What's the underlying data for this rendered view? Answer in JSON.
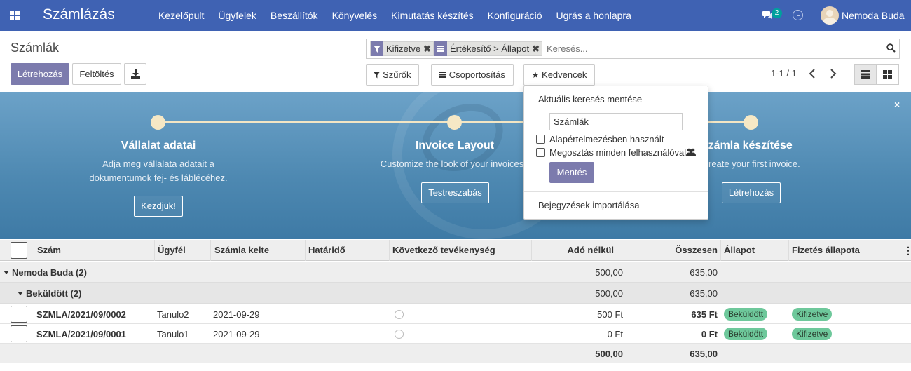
{
  "navbar": {
    "brand": "Számlázás",
    "menu": [
      "Kezelőpult",
      "Ügyfelek",
      "Beszállítók",
      "Könyvelés",
      "Kimutatás készítés",
      "Konfiguráció",
      "Ugrás a honlapra"
    ],
    "chat_count": "2",
    "user": "Nemoda Buda",
    "icons": [
      "apps-icon",
      "chat-icon",
      "clock-icon",
      "avatar"
    ]
  },
  "control": {
    "breadcrumb": "Számlák",
    "create_label": "Létrehozás",
    "upload_label": "Feltöltés",
    "filters_label": "Szűrők",
    "groupby_label": "Csoportosítás",
    "favorites_label": "Kedvencek",
    "pager": "1-1 / 1"
  },
  "search": {
    "facets": [
      {
        "icon": "filter-icon",
        "label": "Kifizetve"
      },
      {
        "icon": "groupby-icon",
        "label": "Értékesítő > Állapot"
      }
    ],
    "placeholder": "Keresés..."
  },
  "banner": {
    "steps": [
      {
        "title": "Vállalat adatai",
        "desc": "Adja meg vállalata adatait a dokumentumok fej- és láblécéhez.",
        "button": "Kezdjük!"
      },
      {
        "title": "Invoice Layout",
        "desc": "Customize the look of your invoices",
        "button": "Testreszabás"
      },
      {
        "title": "Számla készítése",
        "desc": "reate your first invoice.",
        "button": "Létrehozás"
      }
    ],
    "close": "×"
  },
  "favorites_dropdown": {
    "title": "Aktuális keresés mentése",
    "name_value": "Számlák",
    "default_label": "Alapértelmezésben használt",
    "share_label": "Megosztás minden felhasználóval",
    "save_label": "Mentés",
    "import_label": "Bejegyzések importálása"
  },
  "table": {
    "columns": [
      "Szám",
      "Ügyfél",
      "Számla kelte",
      "Határidő",
      "Következő tevékenység",
      "Adó nélkül",
      "Összesen",
      "Állapot",
      "Fizetés állapota"
    ],
    "groups": [
      {
        "label": "Nemoda Buda (2)",
        "untaxed": "500,00",
        "total": "635,00"
      },
      {
        "label": "Beküldött (2)",
        "untaxed": "500,00",
        "total": "635,00"
      }
    ],
    "rows": [
      {
        "number": "SZMLA/2021/09/0002",
        "partner": "Tanulo2",
        "date": "2021-09-29",
        "due": "",
        "untaxed": "500 Ft",
        "total": "635 Ft",
        "state": "Beküldött",
        "payment": "Kifizetve"
      },
      {
        "number": "SZMLA/2021/09/0001",
        "partner": "Tanulo1",
        "date": "2021-09-29",
        "due": "",
        "untaxed": "0 Ft",
        "total": "0 Ft",
        "state": "Beküldött",
        "payment": "Kifizetve"
      }
    ],
    "footer": {
      "untaxed": "500,00",
      "total": "635,00"
    }
  },
  "colors": {
    "navbar": "#3f62b3",
    "primary": "#7c7bad",
    "badge": "#6ec89b",
    "chat_badge": "#00a09d"
  }
}
